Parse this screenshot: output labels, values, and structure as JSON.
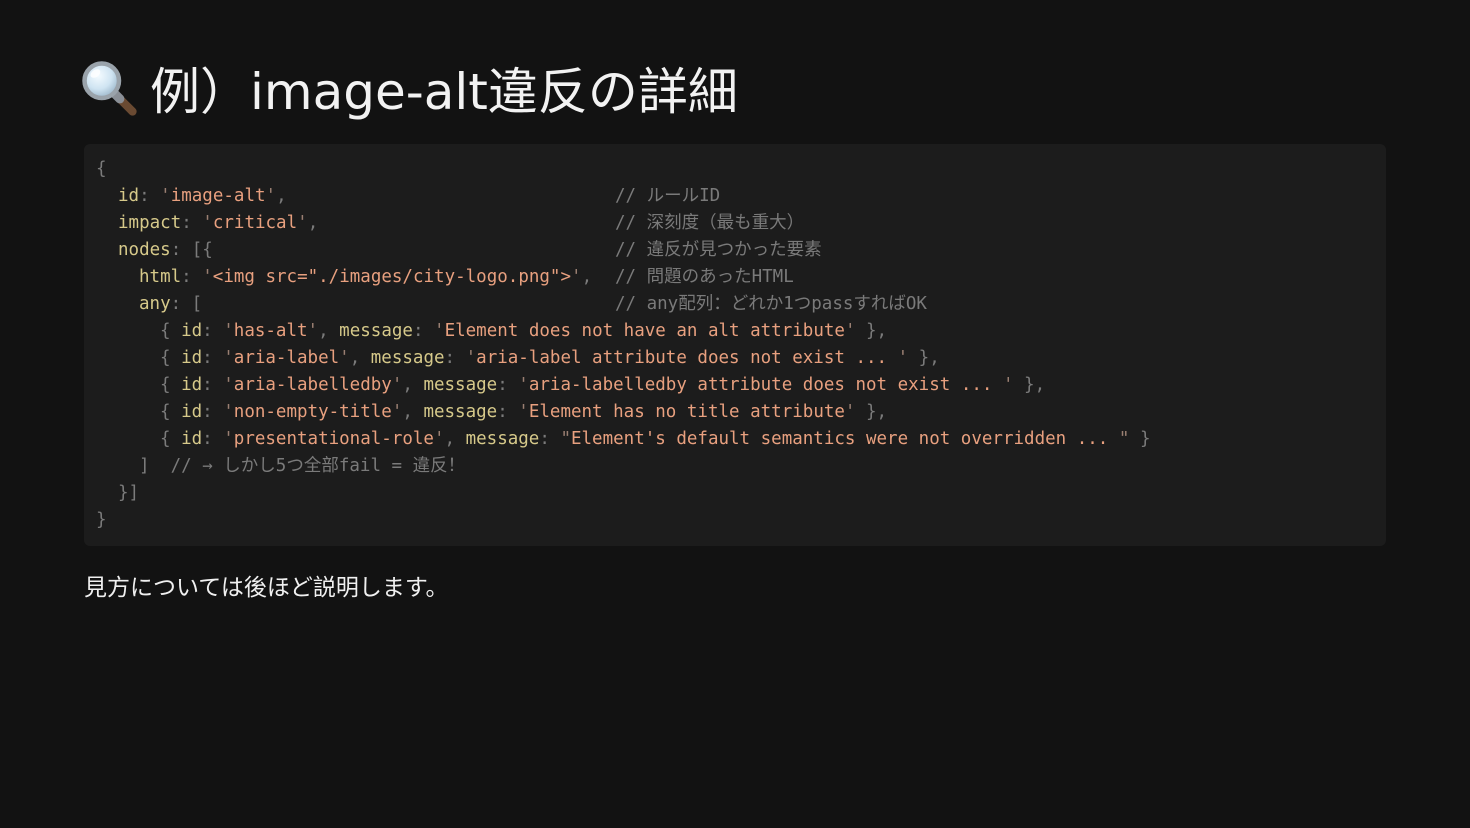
{
  "slide": {
    "title_icon": "magnifying-glass-icon",
    "title": "例）image-alt違反の詳細",
    "caption": "見方については後ほど説明します。"
  },
  "code": {
    "open_brace": "{",
    "close_nodes": "}]",
    "close_brace": "}",
    "id_key": "id",
    "id_value": "image-alt",
    "impact_key": "impact",
    "impact_value": "critical",
    "nodes_key": "nodes",
    "html_key": "html",
    "html_value": "<img src=\"./images/city-logo.png\">",
    "any_key": "any",
    "any_close": "]",
    "any_close_comment": "// → しかし5つ全部fail = 違反！",
    "comments": {
      "id": "// ルールID",
      "impact": "// 深刻度（最も重大）",
      "nodes": "// 違反が見つかった要素",
      "html": "// 問題のあったHTML",
      "any": "// any配列：どれか1つpassすればOK"
    },
    "checks": [
      {
        "id": "has-alt",
        "message": "Element does not have an alt attribute",
        "quote": "single"
      },
      {
        "id": "aria-label",
        "message": "aria-label attribute does not exist ... ",
        "quote": "single"
      },
      {
        "id": "aria-labelledby",
        "message": "aria-labelledby attribute does not exist ... ",
        "quote": "single"
      },
      {
        "id": "non-empty-title",
        "message": "Element has no title attribute",
        "quote": "single"
      },
      {
        "id": "presentational-role",
        "message": "Element's default semantics were not overridden ... ",
        "quote": "double"
      }
    ]
  }
}
